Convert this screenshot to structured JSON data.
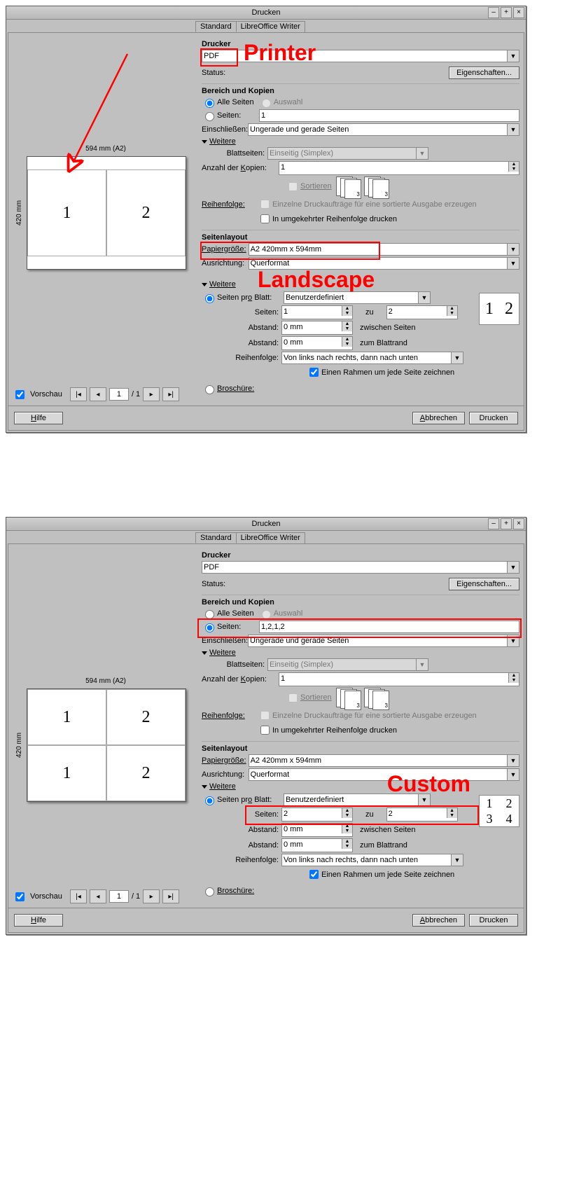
{
  "dialog1": {
    "title": "Drucken",
    "tabs": {
      "standard": "Standard",
      "writer": "LibreOffice Writer"
    },
    "printer": {
      "section": "Drucker",
      "value": "PDF",
      "status_label": "Status:",
      "properties_btn": "Eigenschaften..."
    },
    "range": {
      "section": "Bereich und Kopien",
      "all": "Alle Seiten",
      "selection": "Auswahl",
      "pages_label": "Seiten:",
      "pages_val": "1",
      "include_label": "Einschließen:",
      "include_val": "Ungerade und gerade Seiten",
      "more": "Weitere",
      "sheets_label": "Blattseiten:",
      "sheets_val": "Einseitig (Simplex)",
      "copies_label": "Anzahl der Kopien:",
      "copies_val": "1",
      "sort": "Sortieren",
      "order_label": "Reihenfolge:",
      "order_chk1": "Einzelne Druckaufträge für eine sortierte Ausgabe erzeugen",
      "order_chk2": "In umgekehrter Reihenfolge drucken"
    },
    "layout": {
      "section": "Seitenlayout",
      "paper_label": "Papiergröße:",
      "paper_val": "A2 420mm x 594mm",
      "orient_label": "Ausrichtung:",
      "orient_val": "Querformat",
      "more": "Weitere",
      "ppsheet_label": "Seiten pro Blatt:",
      "ppsheet_val": "Benutzerdefiniert",
      "pages_label": "Seiten:",
      "pages_val1": "1",
      "pages_to": "zu",
      "pages_val2": "2",
      "gap_label": "Abstand:",
      "gap_val1": "0 mm",
      "gap_txt1": "zwischen Seiten",
      "gap_val2": "0 mm",
      "gap_txt2": "zum Blattrand",
      "porder_label": "Reihenfolge:",
      "porder_val": "Von links nach rechts, dann nach unten",
      "frame_chk": "Einen Rahmen um jede Seite zeichnen",
      "brochure": "Broschüre:",
      "thumb": [
        "1",
        "2"
      ]
    },
    "preview": {
      "check": "Vorschau",
      "page": "1",
      "total": "/ 1",
      "dim_top": "594 mm (A2)",
      "dim_left": "420 mm",
      "cells": [
        "1",
        "2"
      ]
    },
    "footer": {
      "help": "Hilfe",
      "cancel": "Abbrechen",
      "print": "Drucken"
    },
    "annot": {
      "printer": "Printer",
      "landscape": "Landscape"
    }
  },
  "dialog2": {
    "title": "Drucken",
    "tabs": {
      "standard": "Standard",
      "writer": "LibreOffice Writer"
    },
    "printer": {
      "section": "Drucker",
      "value": "PDF",
      "status_label": "Status:",
      "properties_btn": "Eigenschaften..."
    },
    "range": {
      "section": "Bereich und Kopien",
      "all": "Alle Seiten",
      "selection": "Auswahl",
      "pages_label": "Seiten:",
      "pages_val": "1,2,1,2",
      "include_label": "Einschließen:",
      "include_val": "Ungerade und gerade Seiten",
      "more": "Weitere",
      "sheets_label": "Blattseiten:",
      "sheets_val": "Einseitig (Simplex)",
      "copies_label": "Anzahl der Kopien:",
      "copies_val": "1",
      "sort": "Sortieren",
      "order_label": "Reihenfolge:",
      "order_chk1": "Einzelne Druckaufträge für eine sortierte Ausgabe erzeugen",
      "order_chk2": "In umgekehrter Reihenfolge drucken"
    },
    "layout": {
      "section": "Seitenlayout",
      "paper_label": "Papiergröße:",
      "paper_val": "A2 420mm x 594mm",
      "orient_label": "Ausrichtung:",
      "orient_val": "Querformat",
      "more": "Weitere",
      "ppsheet_label": "Seiten pro Blatt:",
      "ppsheet_val": "Benutzerdefiniert",
      "pages_label": "Seiten:",
      "pages_val1": "2",
      "pages_to": "zu",
      "pages_val2": "2",
      "gap_label": "Abstand:",
      "gap_val1": "0 mm",
      "gap_txt1": "zwischen Seiten",
      "gap_val2": "0 mm",
      "gap_txt2": "zum Blattrand",
      "porder_label": "Reihenfolge:",
      "porder_val": "Von links nach rechts, dann nach unten",
      "frame_chk": "Einen Rahmen um jede Seite zeichnen",
      "brochure": "Broschüre:",
      "thumb": [
        "1",
        "2",
        "3",
        "4"
      ]
    },
    "preview": {
      "check": "Vorschau",
      "page": "1",
      "total": "/ 1",
      "dim_top": "594 mm (A2)",
      "dim_left": "420 mm",
      "cells": [
        "1",
        "2",
        "1",
        "2"
      ]
    },
    "footer": {
      "help": "Hilfe",
      "cancel": "Abbrechen",
      "print": "Drucken"
    },
    "annot": {
      "custom": "Custom"
    }
  }
}
